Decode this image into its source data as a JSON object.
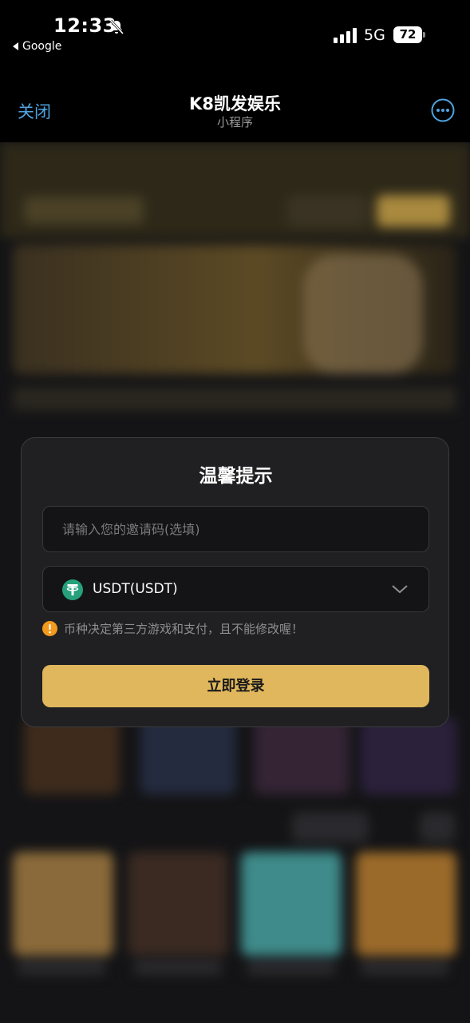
{
  "status_bar": {
    "time": "12:33",
    "back_app": "Google",
    "network": "5G",
    "battery": "72"
  },
  "nav": {
    "close_label": "关闭",
    "title": "K8凯发娱乐",
    "subtitle": "小程序"
  },
  "modal": {
    "title": "温馨提示",
    "invite_placeholder": "请输入您的邀请码(选填)",
    "invite_value": "",
    "currency_selected": "USDT(USDT)",
    "warning": "币种决定第三方游戏和支付，且不能修改喔！",
    "login_label": "立即登录"
  },
  "colors": {
    "accent_blue": "#4fa3e0",
    "gold": "#e0b75c",
    "usdt_green": "#26a17b",
    "warning_orange": "#f29a1e"
  }
}
